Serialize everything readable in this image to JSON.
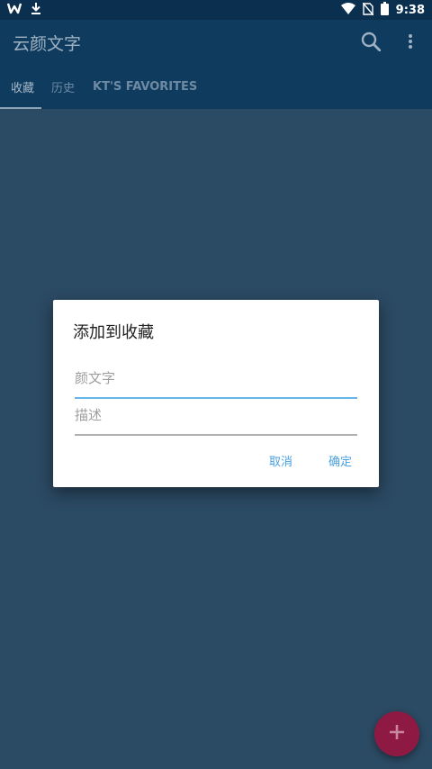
{
  "status_bar": {
    "time": "9:38",
    "left_icons": [
      "w-app-icon",
      "download-icon"
    ],
    "right_icons": [
      "wifi-icon",
      "no-sim-icon",
      "battery-icon"
    ]
  },
  "app_bar": {
    "title": "云颜文字",
    "actions": [
      "search-icon",
      "more-vert-icon"
    ]
  },
  "tabs": [
    {
      "label": "收藏",
      "active": true
    },
    {
      "label": "历史",
      "active": false
    },
    {
      "label": "KT'S FAVORITES",
      "active": false
    }
  ],
  "dialog": {
    "title": "添加到收藏",
    "fields": [
      {
        "placeholder": "颜文字",
        "value": ""
      },
      {
        "placeholder": "描述",
        "value": ""
      }
    ],
    "buttons": {
      "cancel": "取消",
      "confirm": "确定"
    }
  },
  "fab": {
    "icon": "plus-icon"
  },
  "colors": {
    "status_bar": "#0b2f4e",
    "app_bar": "#0f3b5f",
    "background": "#2b4a63",
    "accent": "#4aa1e0",
    "fab": "#8e1a44"
  }
}
